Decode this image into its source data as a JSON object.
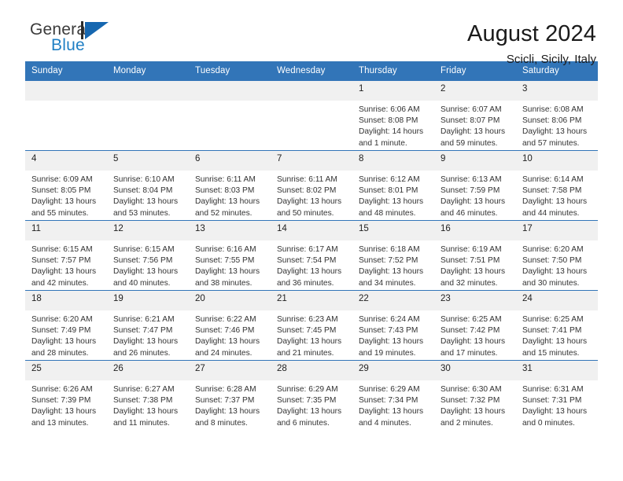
{
  "brand": {
    "name_top": "General",
    "name_bottom": "Blue",
    "accent_color": "#1667b0",
    "text_color": "#3b3b3b"
  },
  "header": {
    "title": "August 2024",
    "subtitle": "Scicli, Sicily, Italy"
  },
  "theme": {
    "header_blue": "#3275b8",
    "daynum_band": "#f0f0f0",
    "body_text": "#333333"
  },
  "calendar": {
    "weekday_headers": [
      "Sunday",
      "Monday",
      "Tuesday",
      "Wednesday",
      "Thursday",
      "Friday",
      "Saturday"
    ],
    "weeks": [
      [
        {
          "day": "",
          "sunrise": "",
          "sunset": "",
          "daylight1": "",
          "daylight2": ""
        },
        {
          "day": "",
          "sunrise": "",
          "sunset": "",
          "daylight1": "",
          "daylight2": ""
        },
        {
          "day": "",
          "sunrise": "",
          "sunset": "",
          "daylight1": "",
          "daylight2": ""
        },
        {
          "day": "",
          "sunrise": "",
          "sunset": "",
          "daylight1": "",
          "daylight2": ""
        },
        {
          "day": "1",
          "sunrise": "Sunrise: 6:06 AM",
          "sunset": "Sunset: 8:08 PM",
          "daylight1": "Daylight: 14 hours",
          "daylight2": "and 1 minute."
        },
        {
          "day": "2",
          "sunrise": "Sunrise: 6:07 AM",
          "sunset": "Sunset: 8:07 PM",
          "daylight1": "Daylight: 13 hours",
          "daylight2": "and 59 minutes."
        },
        {
          "day": "3",
          "sunrise": "Sunrise: 6:08 AM",
          "sunset": "Sunset: 8:06 PM",
          "daylight1": "Daylight: 13 hours",
          "daylight2": "and 57 minutes."
        }
      ],
      [
        {
          "day": "4",
          "sunrise": "Sunrise: 6:09 AM",
          "sunset": "Sunset: 8:05 PM",
          "daylight1": "Daylight: 13 hours",
          "daylight2": "and 55 minutes."
        },
        {
          "day": "5",
          "sunrise": "Sunrise: 6:10 AM",
          "sunset": "Sunset: 8:04 PM",
          "daylight1": "Daylight: 13 hours",
          "daylight2": "and 53 minutes."
        },
        {
          "day": "6",
          "sunrise": "Sunrise: 6:11 AM",
          "sunset": "Sunset: 8:03 PM",
          "daylight1": "Daylight: 13 hours",
          "daylight2": "and 52 minutes."
        },
        {
          "day": "7",
          "sunrise": "Sunrise: 6:11 AM",
          "sunset": "Sunset: 8:02 PM",
          "daylight1": "Daylight: 13 hours",
          "daylight2": "and 50 minutes."
        },
        {
          "day": "8",
          "sunrise": "Sunrise: 6:12 AM",
          "sunset": "Sunset: 8:01 PM",
          "daylight1": "Daylight: 13 hours",
          "daylight2": "and 48 minutes."
        },
        {
          "day": "9",
          "sunrise": "Sunrise: 6:13 AM",
          "sunset": "Sunset: 7:59 PM",
          "daylight1": "Daylight: 13 hours",
          "daylight2": "and 46 minutes."
        },
        {
          "day": "10",
          "sunrise": "Sunrise: 6:14 AM",
          "sunset": "Sunset: 7:58 PM",
          "daylight1": "Daylight: 13 hours",
          "daylight2": "and 44 minutes."
        }
      ],
      [
        {
          "day": "11",
          "sunrise": "Sunrise: 6:15 AM",
          "sunset": "Sunset: 7:57 PM",
          "daylight1": "Daylight: 13 hours",
          "daylight2": "and 42 minutes."
        },
        {
          "day": "12",
          "sunrise": "Sunrise: 6:15 AM",
          "sunset": "Sunset: 7:56 PM",
          "daylight1": "Daylight: 13 hours",
          "daylight2": "and 40 minutes."
        },
        {
          "day": "13",
          "sunrise": "Sunrise: 6:16 AM",
          "sunset": "Sunset: 7:55 PM",
          "daylight1": "Daylight: 13 hours",
          "daylight2": "and 38 minutes."
        },
        {
          "day": "14",
          "sunrise": "Sunrise: 6:17 AM",
          "sunset": "Sunset: 7:54 PM",
          "daylight1": "Daylight: 13 hours",
          "daylight2": "and 36 minutes."
        },
        {
          "day": "15",
          "sunrise": "Sunrise: 6:18 AM",
          "sunset": "Sunset: 7:52 PM",
          "daylight1": "Daylight: 13 hours",
          "daylight2": "and 34 minutes."
        },
        {
          "day": "16",
          "sunrise": "Sunrise: 6:19 AM",
          "sunset": "Sunset: 7:51 PM",
          "daylight1": "Daylight: 13 hours",
          "daylight2": "and 32 minutes."
        },
        {
          "day": "17",
          "sunrise": "Sunrise: 6:20 AM",
          "sunset": "Sunset: 7:50 PM",
          "daylight1": "Daylight: 13 hours",
          "daylight2": "and 30 minutes."
        }
      ],
      [
        {
          "day": "18",
          "sunrise": "Sunrise: 6:20 AM",
          "sunset": "Sunset: 7:49 PM",
          "daylight1": "Daylight: 13 hours",
          "daylight2": "and 28 minutes."
        },
        {
          "day": "19",
          "sunrise": "Sunrise: 6:21 AM",
          "sunset": "Sunset: 7:47 PM",
          "daylight1": "Daylight: 13 hours",
          "daylight2": "and 26 minutes."
        },
        {
          "day": "20",
          "sunrise": "Sunrise: 6:22 AM",
          "sunset": "Sunset: 7:46 PM",
          "daylight1": "Daylight: 13 hours",
          "daylight2": "and 24 minutes."
        },
        {
          "day": "21",
          "sunrise": "Sunrise: 6:23 AM",
          "sunset": "Sunset: 7:45 PM",
          "daylight1": "Daylight: 13 hours",
          "daylight2": "and 21 minutes."
        },
        {
          "day": "22",
          "sunrise": "Sunrise: 6:24 AM",
          "sunset": "Sunset: 7:43 PM",
          "daylight1": "Daylight: 13 hours",
          "daylight2": "and 19 minutes."
        },
        {
          "day": "23",
          "sunrise": "Sunrise: 6:25 AM",
          "sunset": "Sunset: 7:42 PM",
          "daylight1": "Daylight: 13 hours",
          "daylight2": "and 17 minutes."
        },
        {
          "day": "24",
          "sunrise": "Sunrise: 6:25 AM",
          "sunset": "Sunset: 7:41 PM",
          "daylight1": "Daylight: 13 hours",
          "daylight2": "and 15 minutes."
        }
      ],
      [
        {
          "day": "25",
          "sunrise": "Sunrise: 6:26 AM",
          "sunset": "Sunset: 7:39 PM",
          "daylight1": "Daylight: 13 hours",
          "daylight2": "and 13 minutes."
        },
        {
          "day": "26",
          "sunrise": "Sunrise: 6:27 AM",
          "sunset": "Sunset: 7:38 PM",
          "daylight1": "Daylight: 13 hours",
          "daylight2": "and 11 minutes."
        },
        {
          "day": "27",
          "sunrise": "Sunrise: 6:28 AM",
          "sunset": "Sunset: 7:37 PM",
          "daylight1": "Daylight: 13 hours",
          "daylight2": "and 8 minutes."
        },
        {
          "day": "28",
          "sunrise": "Sunrise: 6:29 AM",
          "sunset": "Sunset: 7:35 PM",
          "daylight1": "Daylight: 13 hours",
          "daylight2": "and 6 minutes."
        },
        {
          "day": "29",
          "sunrise": "Sunrise: 6:29 AM",
          "sunset": "Sunset: 7:34 PM",
          "daylight1": "Daylight: 13 hours",
          "daylight2": "and 4 minutes."
        },
        {
          "day": "30",
          "sunrise": "Sunrise: 6:30 AM",
          "sunset": "Sunset: 7:32 PM",
          "daylight1": "Daylight: 13 hours",
          "daylight2": "and 2 minutes."
        },
        {
          "day": "31",
          "sunrise": "Sunrise: 6:31 AM",
          "sunset": "Sunset: 7:31 PM",
          "daylight1": "Daylight: 13 hours",
          "daylight2": "and 0 minutes."
        }
      ]
    ]
  }
}
